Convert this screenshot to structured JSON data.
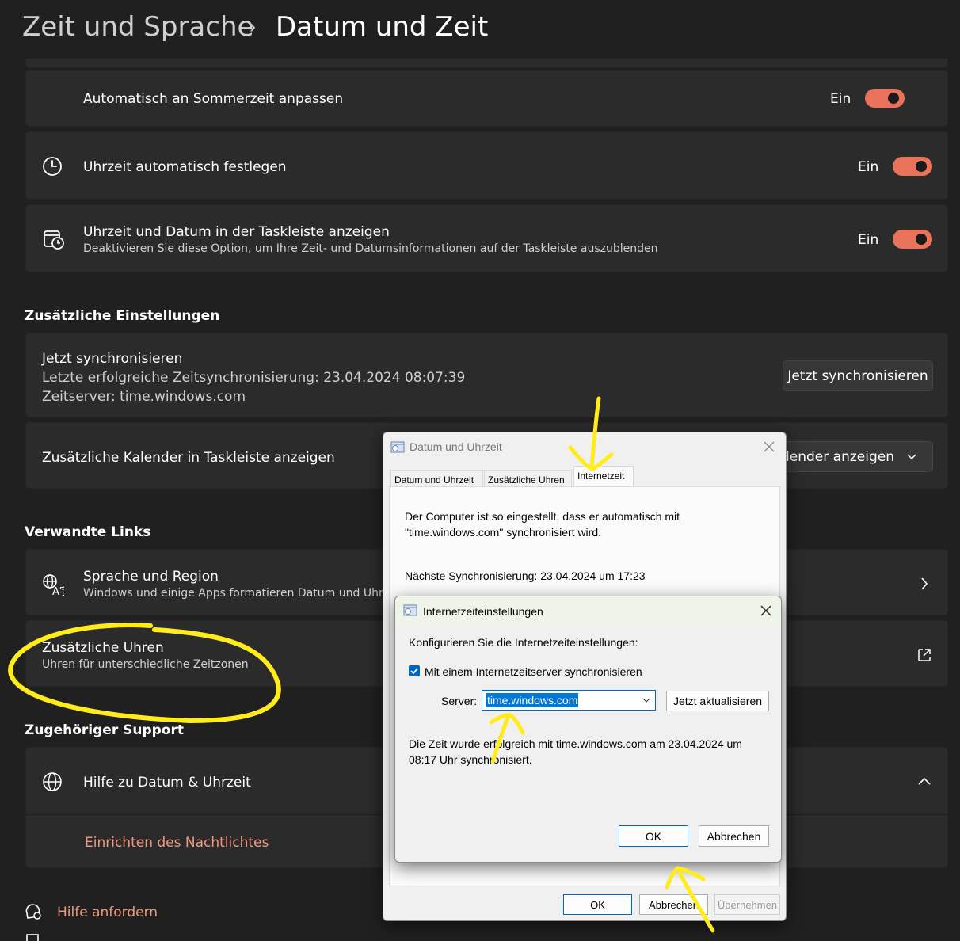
{
  "header": {
    "parent": "Zeit und Sprache",
    "separator": "›",
    "current": "Datum und Zeit"
  },
  "settings": {
    "dst": {
      "title": "Automatisch an Sommerzeit anpassen",
      "state": "Ein"
    },
    "auto_time": {
      "title": "Uhrzeit automatisch festlegen",
      "state": "Ein"
    },
    "taskbar": {
      "title": "Uhrzeit und Datum in der Taskleiste anzeigen",
      "subtitle": "Deaktivieren Sie diese Option, um Ihre Zeit- und Datumsinformationen auf der Taskleiste auszublenden",
      "state": "Ein"
    }
  },
  "additional": {
    "heading": "Zusätzliche Einstellungen",
    "sync": {
      "title": "Jetzt synchronisieren",
      "last": "Letzte erfolgreiche Zeitsynchronisierung: 23.04.2024 08:07:39",
      "server": "Zeitserver: time.windows.com",
      "button": "Jetzt synchronisieren"
    },
    "calendar": {
      "title": "Zusätzliche Kalender in Taskleiste anzeigen",
      "dropdown": "Kalender anzeigen"
    }
  },
  "related": {
    "heading": "Verwandte Links",
    "language": {
      "title": "Sprache und Region",
      "subtitle": "Windows und einige Apps formatieren Datum und Uhrz"
    },
    "clocks": {
      "title": "Zusätzliche Uhren",
      "subtitle": "Uhren für unterschiedliche Zeitzonen"
    }
  },
  "support": {
    "heading": "Zugehöriger Support",
    "help": {
      "title": "Hilfe zu Datum & Uhrzeit",
      "link": "Einrichten des Nachtlichtes"
    },
    "get_help": "Hilfe anfordern"
  },
  "dialog_datetime": {
    "title": "Datum und Uhrzeit",
    "tabs": [
      "Datum und Uhrzeit",
      "Zusätzliche Uhren",
      "Internetzeit"
    ],
    "line1": "Der Computer ist so eingestellt, dass er automatisch mit",
    "line2": "\"time.windows.com\" synchronisiert wird.",
    "next_sync": "Nächste Synchronisierung: 23.04.2024 um 17:23",
    "ok": "OK",
    "cancel": "Abbrechen",
    "apply": "Übernehmen"
  },
  "dialog_internet": {
    "title": "Internetzeiteinstellungen",
    "intro": "Konfigurieren Sie die Internetzeiteinstellungen:",
    "checkbox": "Mit einem Internetzeitserver synchronisieren",
    "checked": true,
    "server_label": "Server:",
    "server_value": "time.windows.com",
    "update_button": "Jetzt aktualisieren",
    "result_line1": "Die Zeit wurde erfolgreich mit time.windows.com am 23.04.2024 um",
    "result_line2": "08:17 Uhr synchronisiert.",
    "ok": "OK",
    "cancel": "Abbrechen"
  },
  "colors": {
    "background": "#202020",
    "card": "#2b2b2b",
    "accent": "#e8735a",
    "annotation": "#ffec1a"
  }
}
